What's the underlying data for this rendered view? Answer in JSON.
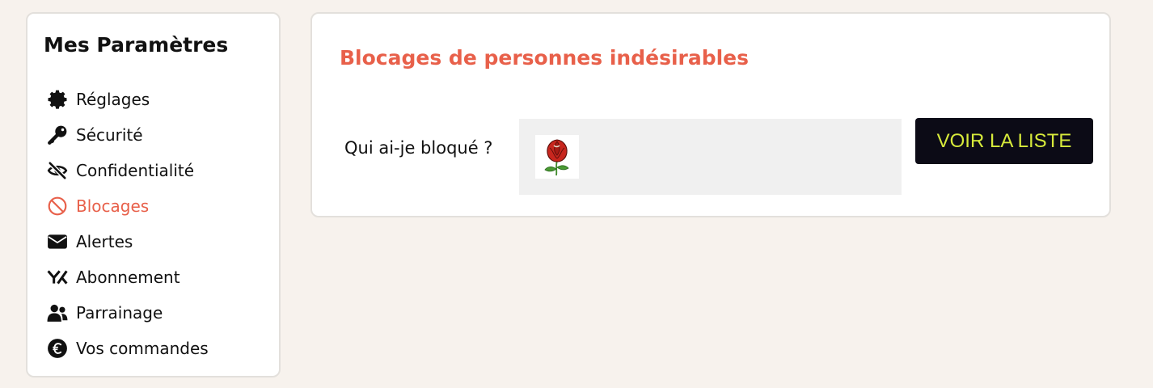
{
  "sidebar": {
    "title": "Mes Paramètres",
    "items": [
      {
        "label": "Réglages",
        "icon": "gear-icon",
        "active": false
      },
      {
        "label": "Sécurité",
        "icon": "key-icon",
        "active": false
      },
      {
        "label": "Confidentialité",
        "icon": "eye-slash-icon",
        "active": false
      },
      {
        "label": "Blocages",
        "icon": "ban-icon",
        "active": true
      },
      {
        "label": "Alertes",
        "icon": "envelope-icon",
        "active": false
      },
      {
        "label": "Abonnement",
        "icon": "brand-yk-icon",
        "active": false
      },
      {
        "label": "Parrainage",
        "icon": "users-icon",
        "active": false
      },
      {
        "label": "Vos commandes",
        "icon": "euro-circle-icon",
        "active": false
      }
    ]
  },
  "main": {
    "title": "Blocages de personnes indésirables",
    "blocked_label": "Qui ai-je bloqué ?",
    "blocked_avatar_icon": "rose-avatar-icon",
    "view_button": "VOIR LA LISTE"
  },
  "colors": {
    "background": "#f7f2ed",
    "accent": "#e8604a",
    "button_bg": "#0c0b16",
    "button_text": "#d7ea3b"
  }
}
